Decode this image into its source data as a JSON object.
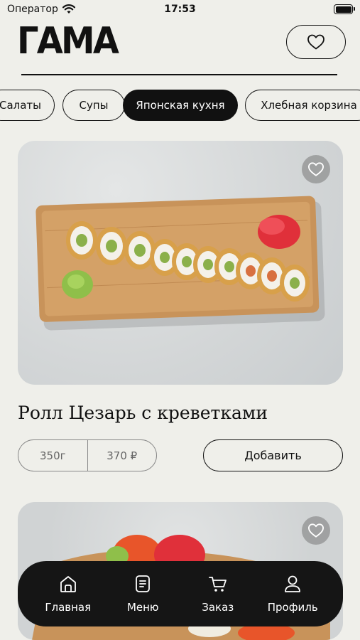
{
  "status_bar": {
    "carrier": "Оператор",
    "time": "17:53"
  },
  "header": {
    "logo": "ГАМА"
  },
  "categories": [
    {
      "label": "Салаты",
      "active": false
    },
    {
      "label": "Супы",
      "active": false
    },
    {
      "label": "Японская кухня",
      "active": true
    },
    {
      "label": "Хлебная корзина",
      "active": false
    }
  ],
  "product": {
    "title": "Ролл Цезарь с креветками",
    "weight": "350г",
    "price": "370 ₽",
    "add_label": "Добавить"
  },
  "tab_bar": {
    "items": [
      {
        "label": "Главная",
        "icon": "home-icon"
      },
      {
        "label": "Меню",
        "icon": "menu-icon"
      },
      {
        "label": "Заказ",
        "icon": "cart-icon"
      },
      {
        "label": "Профиль",
        "icon": "profile-icon"
      }
    ]
  },
  "colors": {
    "background": "#efefea",
    "accent": "#111111",
    "tab_bar": "#151515"
  }
}
